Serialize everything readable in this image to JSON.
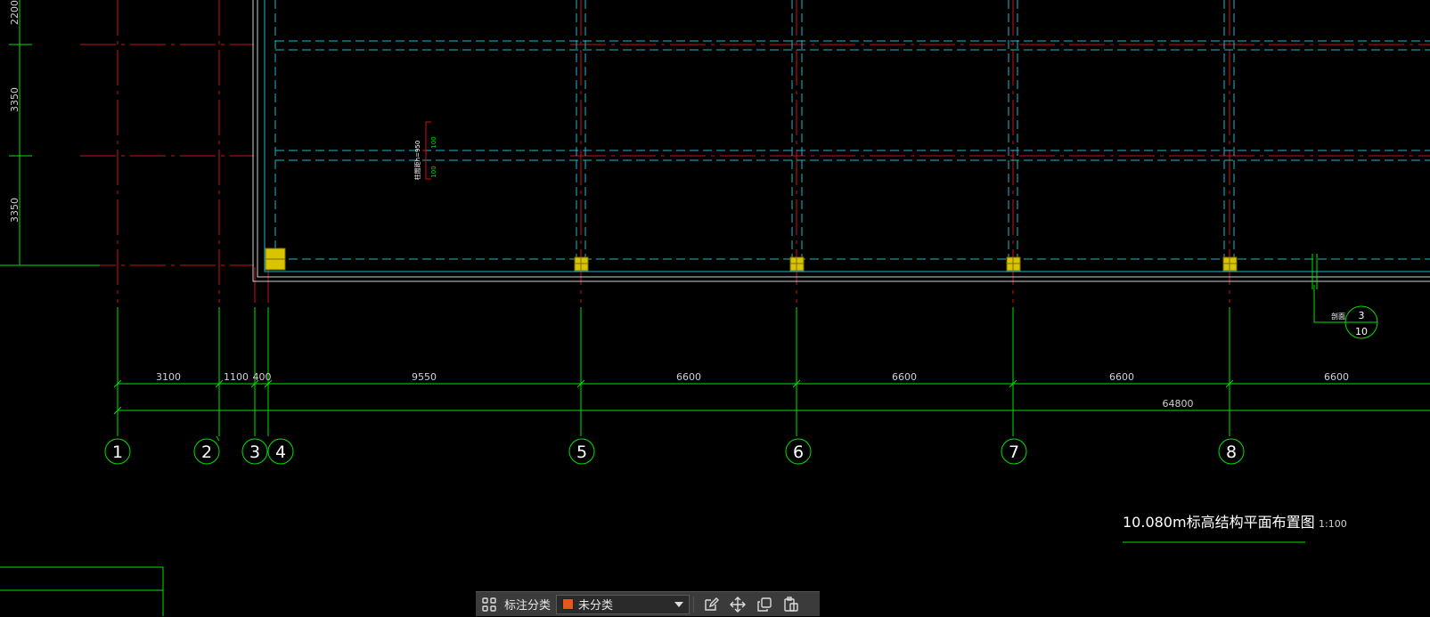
{
  "drawing": {
    "left_dims": [
      "2200",
      "3350",
      "3350"
    ],
    "section_tag": "剖面",
    "section_mark": {
      "num": "3",
      "sheet": "10"
    },
    "note": {
      "label": "柱間距h=950",
      "dim1": "100",
      "dim2": "100"
    },
    "span_dims": [
      "3100",
      "1100",
      "400",
      "9550",
      "6600",
      "6600",
      "6600",
      "6600"
    ],
    "total_dim": "64800",
    "axes": [
      "1",
      "2",
      "3",
      "4",
      "5",
      "6",
      "7",
      "8"
    ],
    "title": "10.080m标高结构平面布置图",
    "scale": "1:100"
  },
  "colors": {
    "grid_red": "#c8141e",
    "line_green": "#00e000",
    "beam_cyan": "#1fb8c8",
    "wall_white": "#d0d0d0",
    "column_yellow": "#d8c400"
  },
  "toolbar": {
    "grid_icon": "grid-icon",
    "category_label": "标注分类",
    "category_value": "未分类",
    "category_color": "#e8561e",
    "tools": [
      "edit-icon",
      "move-icon",
      "copy-icon",
      "paste-icon"
    ]
  }
}
